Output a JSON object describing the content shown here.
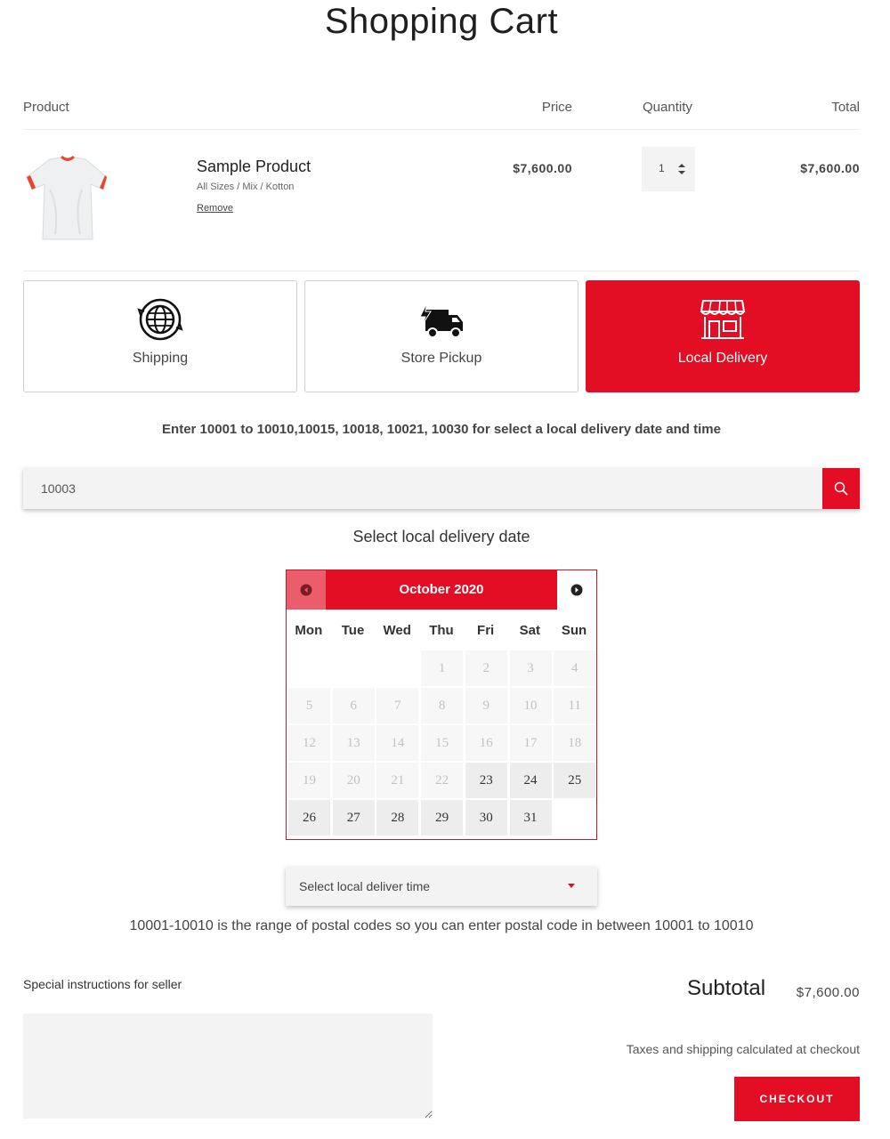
{
  "page": {
    "title": "Shopping Cart"
  },
  "cart": {
    "headers": {
      "product": "Product",
      "price": "Price",
      "quantity": "Quantity",
      "total": "Total"
    },
    "items": [
      {
        "name": "Sample Product",
        "variant": "All Sizes / Mix / Kotton",
        "remove_label": "Remove",
        "price": "$7,600.00",
        "quantity": "1",
        "total": "$7,600.00",
        "image_icon": "tshirt-image"
      }
    ]
  },
  "delivery_methods": [
    {
      "label": "Shipping",
      "icon": "globe-icon",
      "selected": false
    },
    {
      "label": "Store Pickup",
      "icon": "truck-icon",
      "selected": false
    },
    {
      "label": "Local Delivery",
      "icon": "storefront-icon",
      "selected": true
    }
  ],
  "local_delivery": {
    "hint": "Enter 10001 to 10010,10015, 10018, 10021, 10030 for select a local delivery date and time",
    "zip_value": "10003",
    "date_heading": "Select local delivery date",
    "calendar": {
      "month": "October 2020",
      "weekdays": [
        "Mon",
        "Tue",
        "Wed",
        "Thu",
        "Fri",
        "Sat",
        "Sun"
      ],
      "first_weekday_index": 3,
      "days_in_month": 31,
      "first_available_day": 23
    },
    "time_placeholder": "Select local deliver time",
    "range_note": "10001-10010 is the range of postal codes so you can enter postal code in between 10001 to 10010"
  },
  "footer": {
    "instructions_label": "Special instructions for seller",
    "subtotal_label": "Subtotal",
    "subtotal_value": "$7,600.00",
    "taxes_note": "Taxes and shipping calculated at checkout",
    "checkout_label": "CHECKOUT"
  },
  "colors": {
    "accent": "#e30e23",
    "accent_light": "#ec5d6b",
    "input_bg": "#f3f3f3"
  }
}
